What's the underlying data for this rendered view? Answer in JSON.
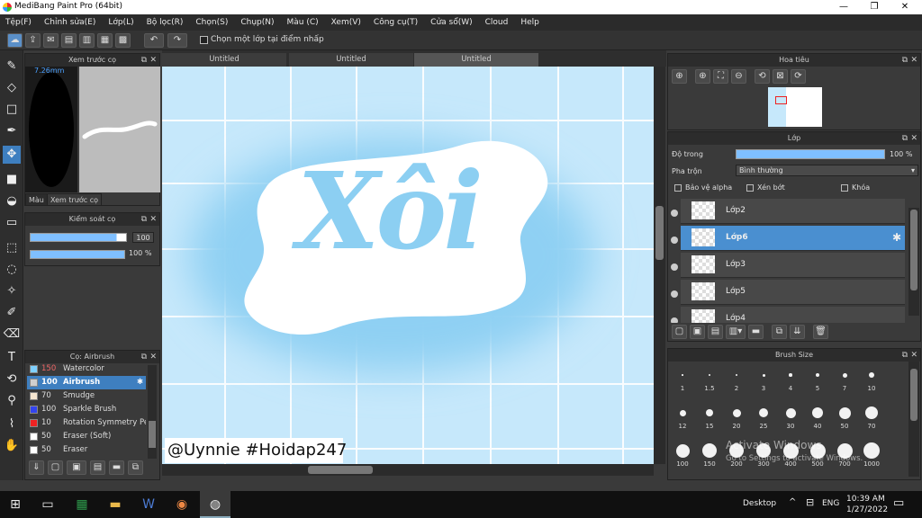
{
  "window": {
    "title": "MediBang Paint Pro (64bit)"
  },
  "menu": [
    "Tệp(F)",
    "Chỉnh sửa(E)",
    "Lớp(L)",
    "Bộ lọc(R)",
    "Chọn(S)",
    "Chụp(N)",
    "Màu (C)",
    "Xem(V)",
    "Công cụ(T)",
    "Cửa sổ(W)",
    "Cloud",
    "Help"
  ],
  "toolbar": {
    "select_layer_label": "Chọn một lớp tại điểm nhấp"
  },
  "brush_preview": {
    "title": "Xem trước cọ",
    "size": "7.26mm",
    "tab_color": "Màu",
    "tab_preview": "Xem trước cọ"
  },
  "brush_control": {
    "title": "Kiểm soát cọ",
    "size_value": "100",
    "opacity_value": "100 %"
  },
  "brush_list": {
    "title": "Cọ: Airbrush",
    "items": [
      {
        "size": "150",
        "name": "Watercolor",
        "color": "#7fd0ff"
      },
      {
        "size": "100",
        "name": "Airbrush",
        "color": "#cfcfcf"
      },
      {
        "size": "70",
        "name": "Smudge",
        "color": "#f5e6d0"
      },
      {
        "size": "100",
        "name": "Sparkle Brush",
        "color": "#3344ee"
      },
      {
        "size": "10",
        "name": "Rotation Symmetry Pe",
        "color": "#ee2222"
      },
      {
        "size": "50",
        "name": "Eraser (Soft)",
        "color": "#ffffff"
      },
      {
        "size": "50",
        "name": "Eraser",
        "color": "#ffffff"
      }
    ]
  },
  "documents": {
    "tabs": [
      "Untitled",
      "Untitled",
      "Untitled"
    ]
  },
  "canvas": {
    "art_text": "Xôi",
    "watermark": "@Uynnie #Hoidap247"
  },
  "navigator": {
    "title": "Hoa tiêu"
  },
  "layers": {
    "title": "Lớp",
    "opacity_label": "Độ trong",
    "opacity_value": "100 %",
    "blend_label": "Pha trộn",
    "blend_value": "Bình thường",
    "protect_alpha": "Bảo vệ alpha",
    "clipping": "Xén bớt",
    "lock": "Khóa",
    "items": [
      "Lớp2",
      "Lớp6",
      "Lớp3",
      "Lớp5",
      "Lớp4"
    ]
  },
  "brush_size": {
    "title": "Brush Size",
    "sizes": [
      "1",
      "1.5",
      "2",
      "3",
      "4",
      "5",
      "7",
      "10",
      "12",
      "15",
      "20",
      "25",
      "30",
      "40",
      "50",
      "70",
      "100",
      "150",
      "200",
      "300",
      "400",
      "500",
      "700",
      "1000"
    ]
  },
  "activation": {
    "line1": "Activate Windows",
    "line2": "Go to Settings to activate Windows."
  },
  "taskbar": {
    "desktop": "Desktop",
    "lang": "ENG",
    "time": "10:39 AM",
    "date": "1/27/2022"
  }
}
